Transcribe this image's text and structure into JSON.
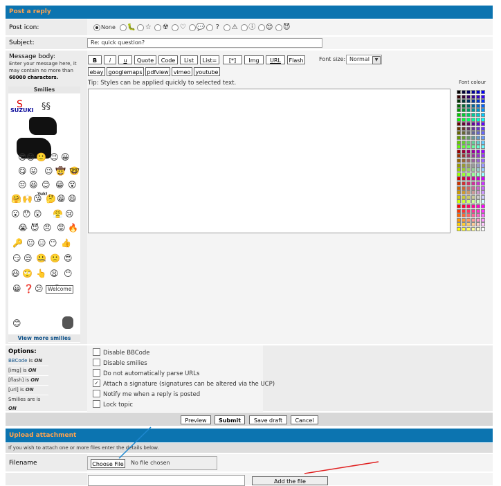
{
  "reply_header": "Post a reply",
  "post_icon": {
    "label": "Post icon:",
    "none_label": "None",
    "icons": [
      "🐛",
      "☆",
      "☢",
      "♡",
      "💬",
      "?",
      "⚠",
      "ⓘ",
      "😊",
      "😈"
    ]
  },
  "subject": {
    "label": "Subject:",
    "value": "Re: quick question?"
  },
  "message": {
    "label": "Message body:",
    "help": "Enter your message here, it may contain no more than",
    "limit": "60000 characters."
  },
  "toolbar": {
    "buttons": [
      "B",
      "i",
      "u",
      "Quote",
      "Code",
      "List",
      "List=",
      "[*]",
      "Img",
      "URL",
      "Flash"
    ],
    "font_size_label": "Font size:",
    "font_size_value": "Normal",
    "buttons2": [
      "ebay",
      "googlemaps",
      "pdfview",
      "vimeo",
      "youtube"
    ],
    "tip": "Tip: Styles can be applied quickly to selected text.",
    "font_colour_label": "Font colour"
  },
  "smilies": {
    "title": "Smilies",
    "brand": "SUZUKI",
    "yuk": "Yuk!",
    "welcome": "Welcome",
    "view_more": "View more smilies"
  },
  "options": {
    "title": "Options:",
    "items": [
      {
        "key": "BBCode",
        "val": "ON"
      },
      {
        "key": "[img]",
        "val": "ON"
      },
      {
        "key": "[flash]",
        "val": "ON"
      },
      {
        "key": "[url]",
        "val": "ON"
      },
      {
        "key": "Smilies are",
        "val": "ON"
      }
    ],
    "checks": [
      {
        "label": "Disable BBCode",
        "checked": false
      },
      {
        "label": "Disable smilies",
        "checked": false
      },
      {
        "label": "Do not automatically parse URLs",
        "checked": false
      },
      {
        "label": "Attach a signature (signatures can be altered via the UCP)",
        "checked": true
      },
      {
        "label": "Notify me when a reply is posted",
        "checked": false
      },
      {
        "label": "Lock topic",
        "checked": false
      }
    ]
  },
  "actions": {
    "preview": "Preview",
    "submit": "Submit",
    "save": "Save draft",
    "cancel": "Cancel"
  },
  "upload": {
    "header": "Upload attachment",
    "info": "If you wish to attach one or more files enter the details below.",
    "filename_label": "Filename",
    "choose_file": "Choose File",
    "no_file": "No file chosen",
    "add_file": "Add the file"
  },
  "colors": {
    "header": "#0c74b0",
    "header_text": "#ffa34f",
    "row_bg": "#ececec"
  }
}
